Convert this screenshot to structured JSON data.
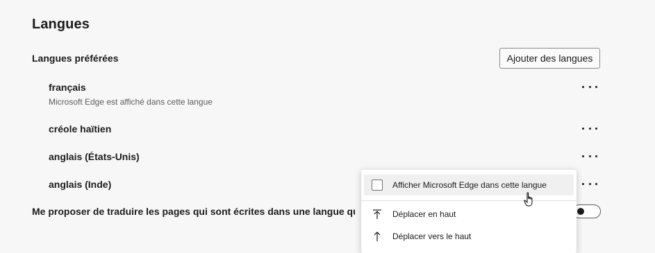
{
  "section": {
    "title": "Langues"
  },
  "preferred": {
    "label": "Langues préférées",
    "add_button": "Ajouter des langues",
    "languages": [
      {
        "name": "français",
        "note": "Microsoft Edge est affiché dans cette langue"
      },
      {
        "name": "créole haïtien"
      },
      {
        "name": "anglais (États-Unis)"
      },
      {
        "name": "anglais (Inde)"
      }
    ]
  },
  "translate": {
    "label": "Me proposer de traduire les pages qui sont écrites dans une langue que je lis pas",
    "toggle_on": false
  },
  "context_menu": {
    "items": [
      {
        "label": "Afficher Microsoft Edge dans cette langue",
        "type": "checkbox",
        "checked": false,
        "icon": "checkbox-icon"
      },
      {
        "label": "Déplacer en haut",
        "icon": "move-to-top-icon"
      },
      {
        "label": "Déplacer vers le haut",
        "icon": "move-up-icon"
      }
    ]
  },
  "colors": {
    "background": "#f7f7f7",
    "text": "#1b1b1b",
    "secondary_text": "#5d5d5d",
    "menu_background": "#ffffff",
    "menu_hover": "#f0f0f0"
  }
}
